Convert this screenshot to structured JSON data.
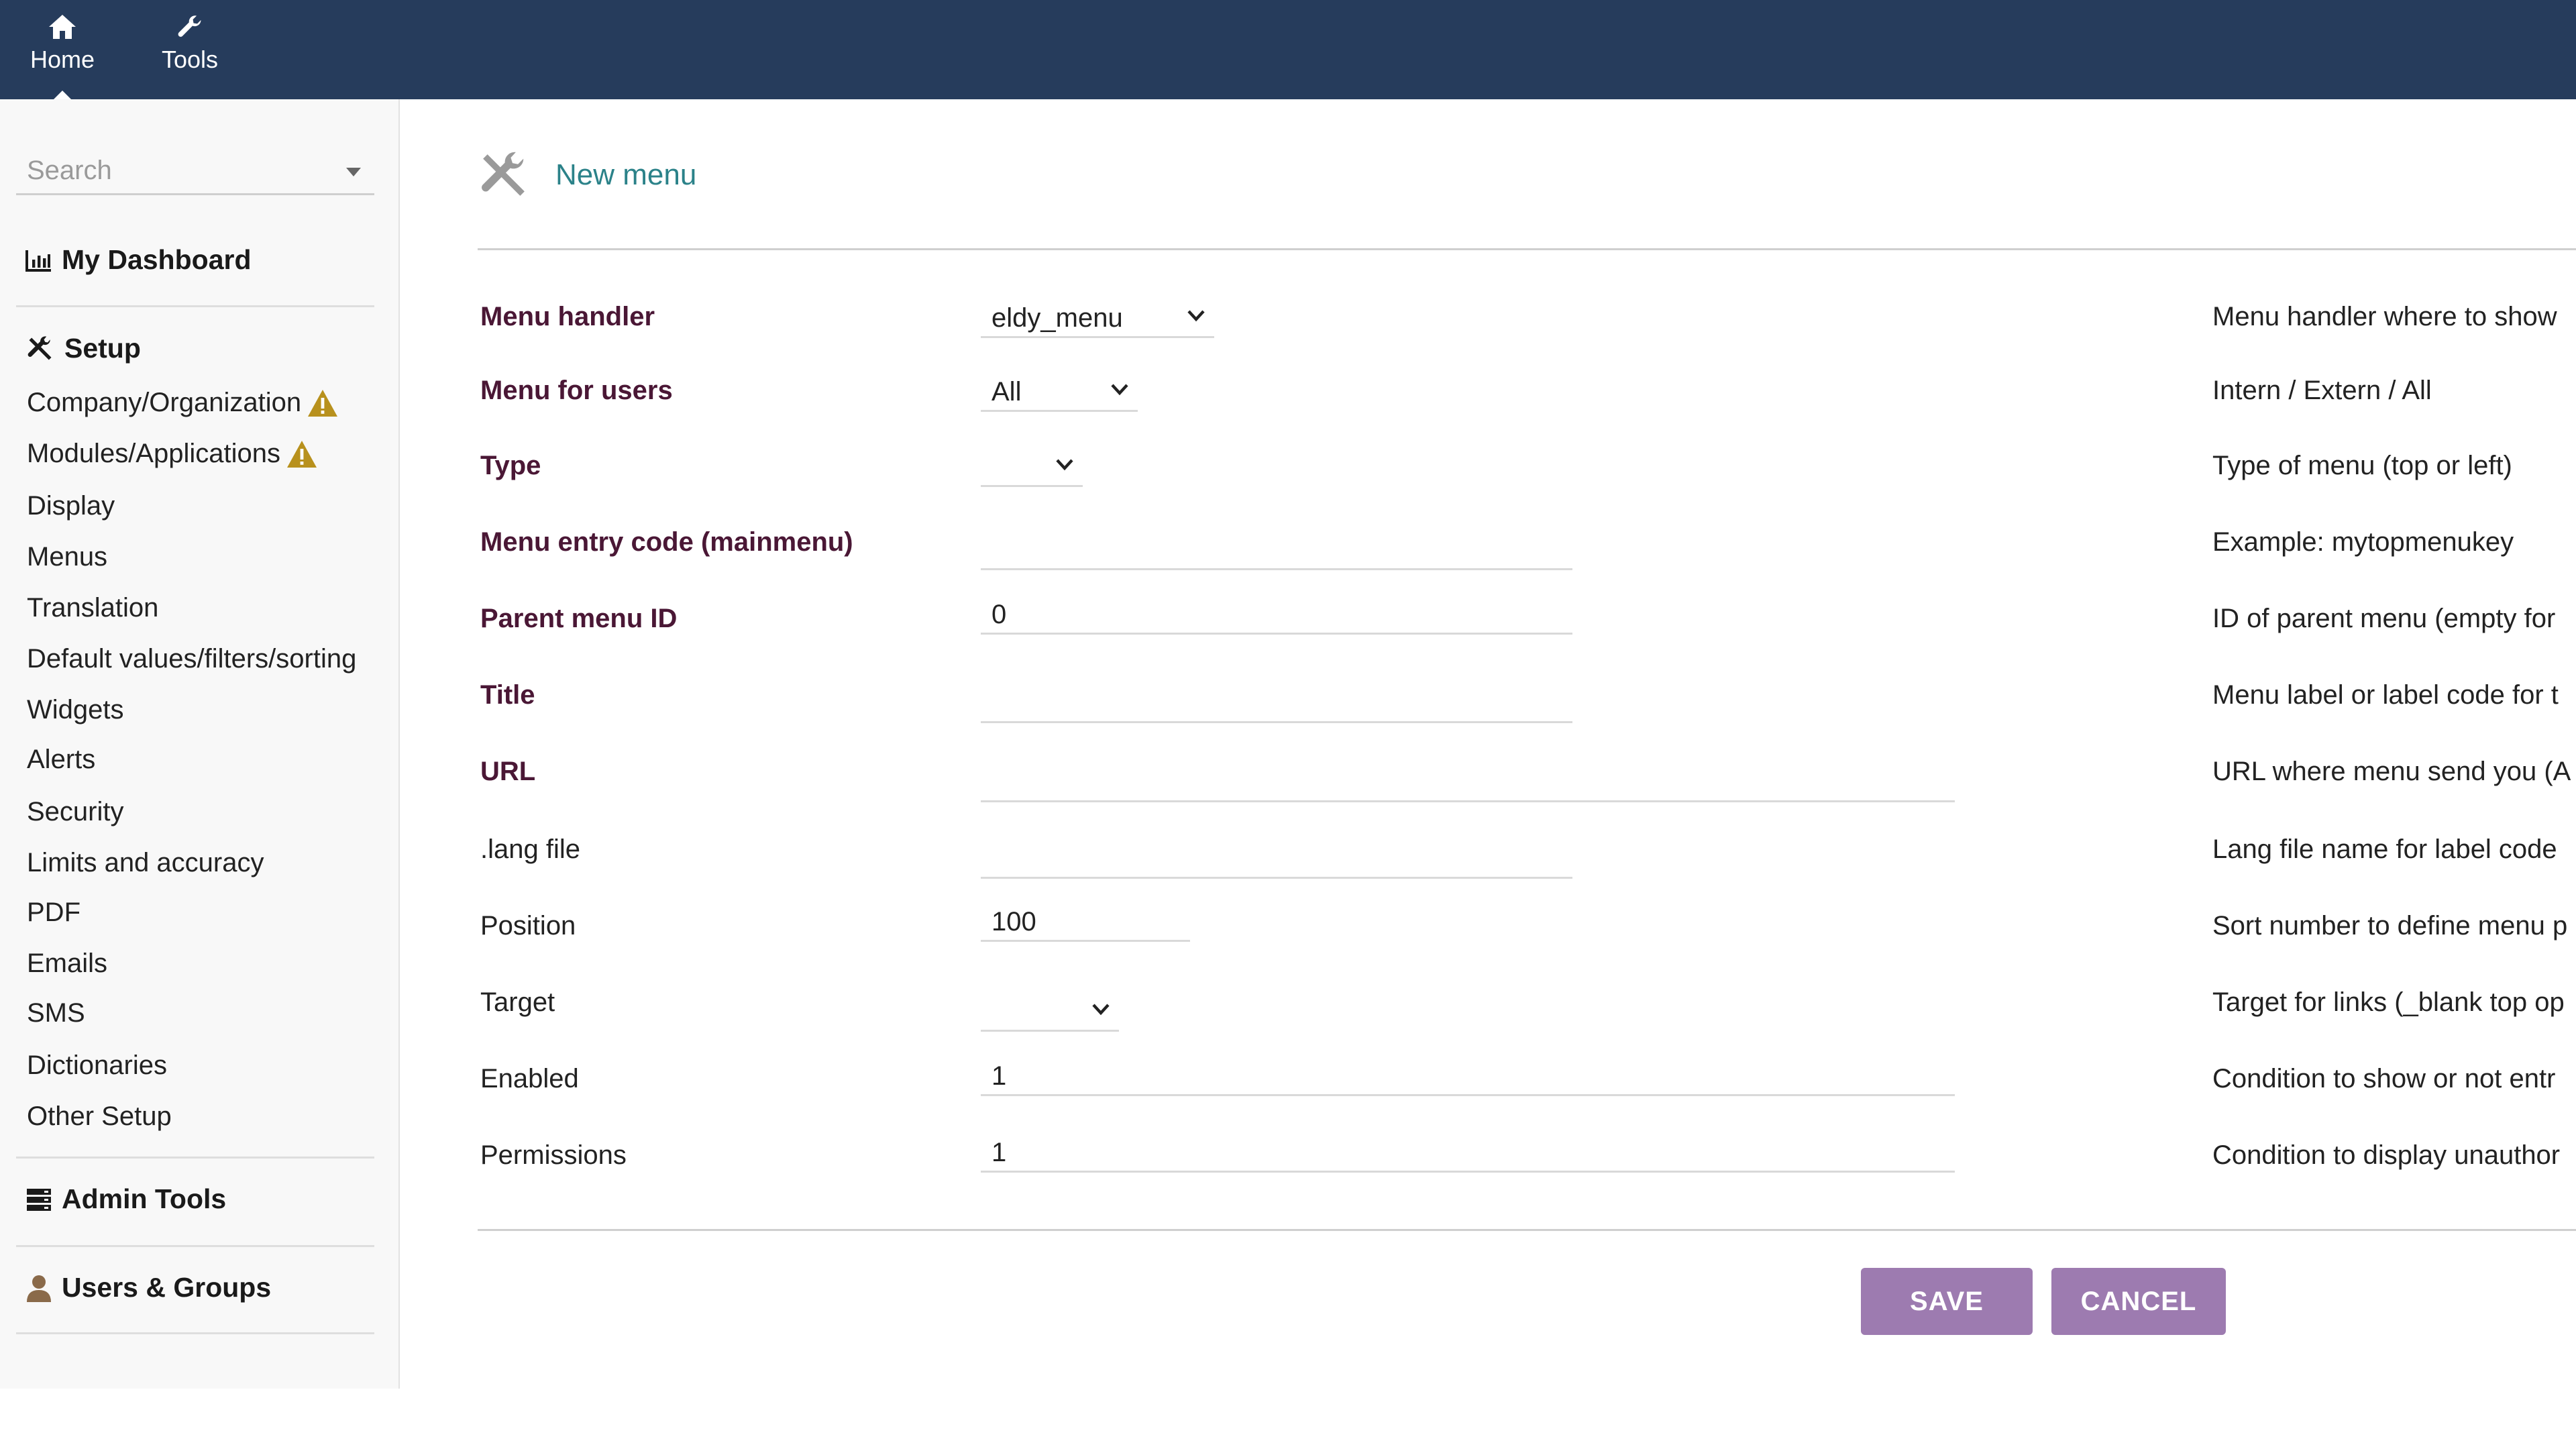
{
  "topnav": {
    "home_label": "Home",
    "tools_label": "Tools"
  },
  "sidebar": {
    "search_placeholder": "Search",
    "dashboard": "My Dashboard",
    "setup": "Setup",
    "setup_items": [
      "Company/Organization",
      "Modules/Applications",
      "Display",
      "Menus",
      "Translation",
      "Default values/filters/sorting",
      "Widgets",
      "Alerts",
      "Security",
      "Limits and accuracy",
      "PDF",
      "Emails",
      "SMS",
      "Dictionaries",
      "Other Setup"
    ],
    "admin_tools": "Admin Tools",
    "users_groups": "Users & Groups"
  },
  "page": {
    "title": "New menu"
  },
  "form": {
    "fields": [
      {
        "label": "Menu handler",
        "value": "eldy_menu",
        "help": "Menu handler where to show"
      },
      {
        "label": "Menu for users",
        "value": "All",
        "help": "Intern / Extern / All"
      },
      {
        "label": "Type",
        "value": "",
        "help": "Type of menu (top or left)"
      },
      {
        "label": "Menu entry code (mainmenu)",
        "value": "",
        "help": "Example: mytopmenukey"
      },
      {
        "label": "Parent menu ID",
        "value": "0",
        "help": "ID of parent menu (empty for"
      },
      {
        "label": "Title",
        "value": "",
        "help": "Menu label or label code for t"
      },
      {
        "label": "URL",
        "value": "",
        "help": "URL where menu send you (A"
      },
      {
        "label": ".lang file",
        "value": "",
        "help": "Lang file name for label code"
      },
      {
        "label": "Position",
        "value": "100",
        "help": "Sort number to define menu p"
      },
      {
        "label": "Target",
        "value": "",
        "help": "Target for links (_blank top op"
      },
      {
        "label": "Enabled",
        "value": "1",
        "help": "Condition to show or not entr"
      },
      {
        "label": "Permissions",
        "value": "1",
        "help": "Condition to display unauthor"
      }
    ]
  },
  "buttons": {
    "save": "SAVE",
    "cancel": "CANCEL"
  },
  "colors": {
    "topbar": "#263c5c",
    "title": "#2b8289",
    "required_label": "#4a1735",
    "button": "#9d7bb0",
    "warning": "#b8911d"
  }
}
